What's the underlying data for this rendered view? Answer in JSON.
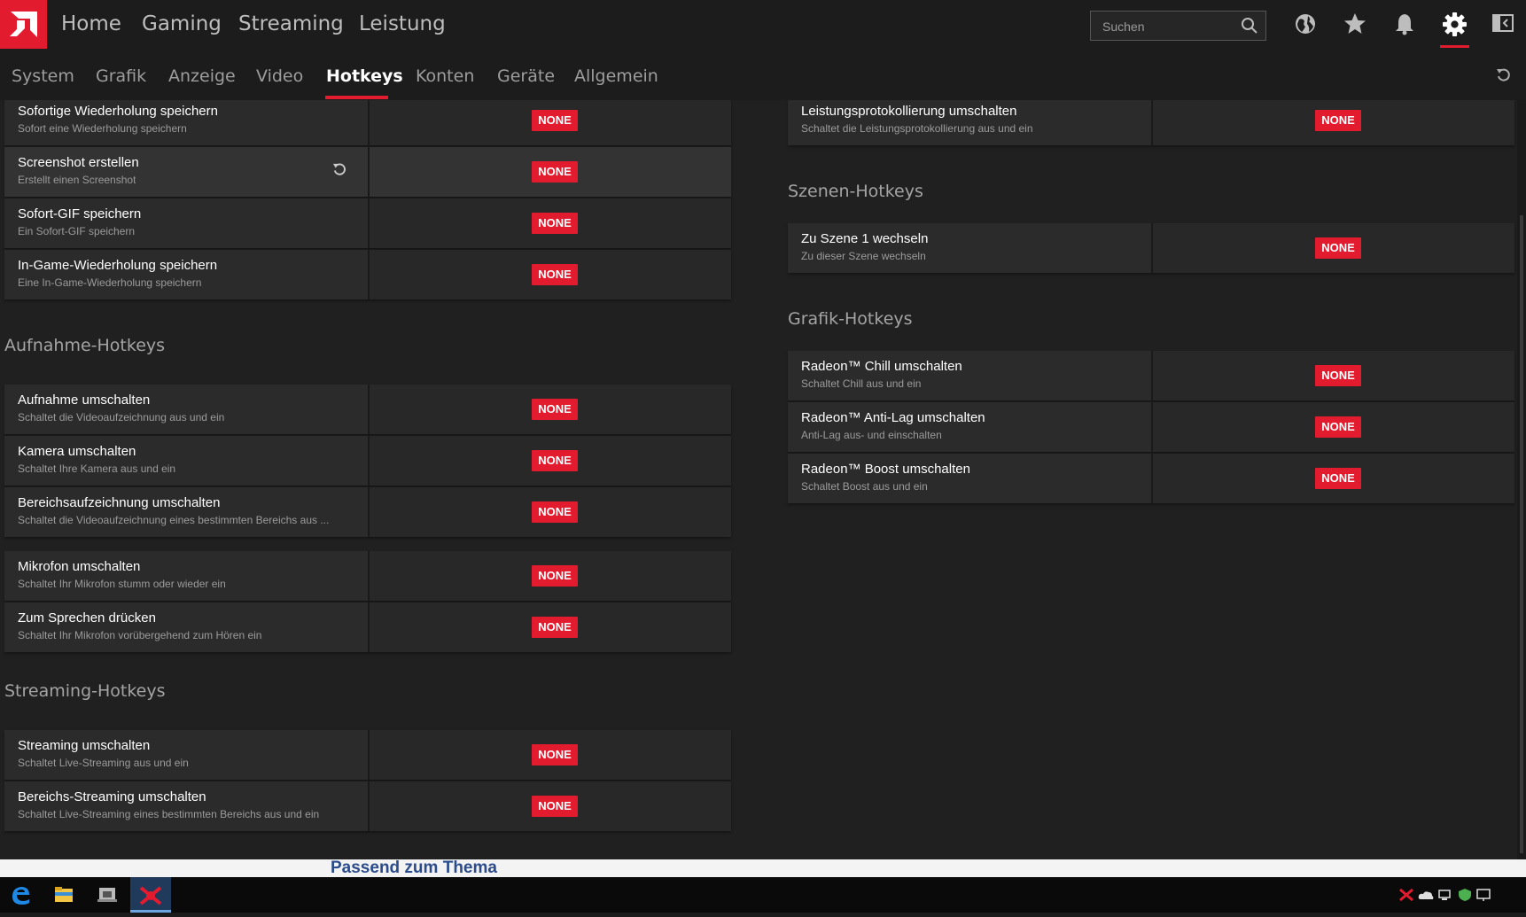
{
  "nav": {
    "home": "Home",
    "gaming": "Gaming",
    "streaming": "Streaming",
    "leistung": "Leistung"
  },
  "search": {
    "placeholder": "Suchen"
  },
  "tabs": [
    "System",
    "Grafik",
    "Anzeige",
    "Video",
    "Hotkeys",
    "Konten",
    "Geräte",
    "Allgemein"
  ],
  "active_tab": "Hotkeys",
  "accent_color": "#e31b2f",
  "badge_text": "NONE",
  "left": {
    "top_rows": [
      {
        "title": "Sofortige Wiederholung speichern",
        "sub": "Sofort eine Wiederholung speichern"
      },
      {
        "title": "Screenshot erstellen",
        "sub": "Erstellt einen Screenshot"
      },
      {
        "title": "Sofort-GIF speichern",
        "sub": "Ein Sofort-GIF speichern"
      },
      {
        "title": "In-Game-Wiederholung speichern",
        "sub": "Eine In-Game-Wiederholung speichern"
      }
    ],
    "aufnahme_title": "Aufnahme-Hotkeys",
    "aufnahme_rows": [
      {
        "title": "Aufnahme umschalten",
        "sub": "Schaltet die Videoaufzeichnung aus und ein"
      },
      {
        "title": "Kamera umschalten",
        "sub": "Schaltet Ihre Kamera aus und ein"
      },
      {
        "title": "Bereichsaufzeichnung umschalten",
        "sub": "Schaltet die Videoaufzeichnung eines bestimmten Bereichs aus ..."
      }
    ],
    "mikro_rows": [
      {
        "title": "Mikrofon umschalten",
        "sub": "Schaltet Ihr Mikrofon stumm oder wieder ein"
      },
      {
        "title": "Zum Sprechen drücken",
        "sub": "Schaltet Ihr Mikrofon vorübergehend zum Hören ein"
      }
    ],
    "streaming_title": "Streaming-Hotkeys",
    "streaming_rows": [
      {
        "title": "Streaming umschalten",
        "sub": "Schaltet Live-Streaming aus und ein"
      },
      {
        "title": "Bereichs-Streaming umschalten",
        "sub": "Schaltet Live-Streaming eines bestimmten Bereichs aus und ein"
      }
    ]
  },
  "right": {
    "top_rows": [
      {
        "title": "Leistungsprotokollierung umschalten",
        "sub": "Schaltet die Leistungsprotokollierung aus und ein"
      }
    ],
    "szenen_title": "Szenen-Hotkeys",
    "szenen_rows": [
      {
        "title": "Zu Szene 1 wechseln",
        "sub": "Zu dieser Szene wechseln"
      }
    ],
    "grafik_title": "Grafik-Hotkeys",
    "grafik_rows": [
      {
        "title": "Radeon™ Chill umschalten",
        "sub": "Schaltet Chill aus und ein"
      },
      {
        "title": "Radeon™ Anti-Lag umschalten",
        "sub": "Anti-Lag aus- und einschalten"
      },
      {
        "title": "Radeon™ Boost umschalten",
        "sub": "Schaltet Boost aus und ein"
      }
    ]
  },
  "background_link": "Passend zum Thema"
}
